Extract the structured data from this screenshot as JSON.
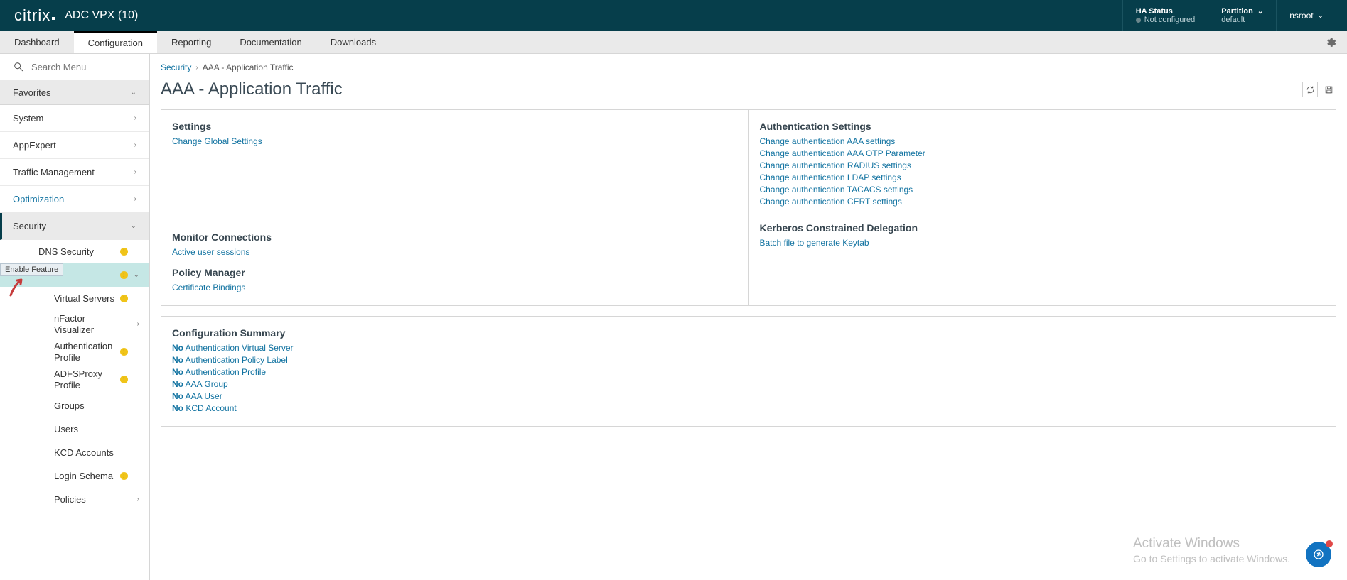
{
  "header": {
    "brand": "citrix",
    "product": "ADC VPX (10)",
    "ha_label": "HA Status",
    "ha_status": "Not configured",
    "partition_label": "Partition",
    "partition_value": "default",
    "user": "nsroot"
  },
  "tabs": {
    "items": [
      "Dashboard",
      "Configuration",
      "Reporting",
      "Documentation",
      "Downloads"
    ],
    "active": "Configuration"
  },
  "sidebar": {
    "search_placeholder": "Search Menu",
    "favorites": "Favorites",
    "top": [
      "System",
      "AppExpert",
      "Traffic Management",
      "Optimization"
    ],
    "security": "Security",
    "tooltip": "Enable Feature",
    "sec_children": {
      "dns": "DNS Security",
      "aaa_hidden": "AAA - Application Traffic",
      "virtual_servers": "Virtual Servers",
      "nfactor": "nFactor Visualizer",
      "auth_profile": "Authentication Profile",
      "adfs": "ADFSProxy Profile",
      "groups": "Groups",
      "users": "Users",
      "kcd": "KCD Accounts",
      "login_schema": "Login Schema",
      "policies": "Policies"
    }
  },
  "breadcrumb": {
    "root": "Security",
    "current": "AAA - Application Traffic"
  },
  "page_title": "AAA - Application Traffic",
  "panels": {
    "settings": {
      "title": "Settings",
      "links": [
        "Change Global Settings"
      ]
    },
    "auth": {
      "title": "Authentication Settings",
      "links": [
        "Change authentication AAA settings",
        "Change authentication AAA OTP Parameter",
        "Change authentication RADIUS settings",
        "Change authentication LDAP settings",
        "Change authentication TACACS settings",
        "Change authentication CERT settings"
      ]
    },
    "monitor": {
      "title": "Monitor Connections",
      "links": [
        "Active user sessions"
      ]
    },
    "kerberos": {
      "title": "Kerberos Constrained Delegation",
      "links": [
        "Batch file to generate Keytab"
      ]
    },
    "policy": {
      "title": "Policy Manager",
      "links": [
        "Certificate Bindings"
      ]
    },
    "summary": {
      "title": "Configuration Summary",
      "items": [
        {
          "count": "No",
          "label": "Authentication Virtual Server"
        },
        {
          "count": "No",
          "label": "Authentication Policy Label"
        },
        {
          "count": "No",
          "label": "Authentication Profile"
        },
        {
          "count": "No",
          "label": "AAA Group"
        },
        {
          "count": "No",
          "label": "AAA User"
        },
        {
          "count": "No",
          "label": "KCD Account"
        }
      ]
    }
  },
  "watermark": {
    "l1": "Activate Windows",
    "l2": "Go to Settings to activate Windows."
  }
}
